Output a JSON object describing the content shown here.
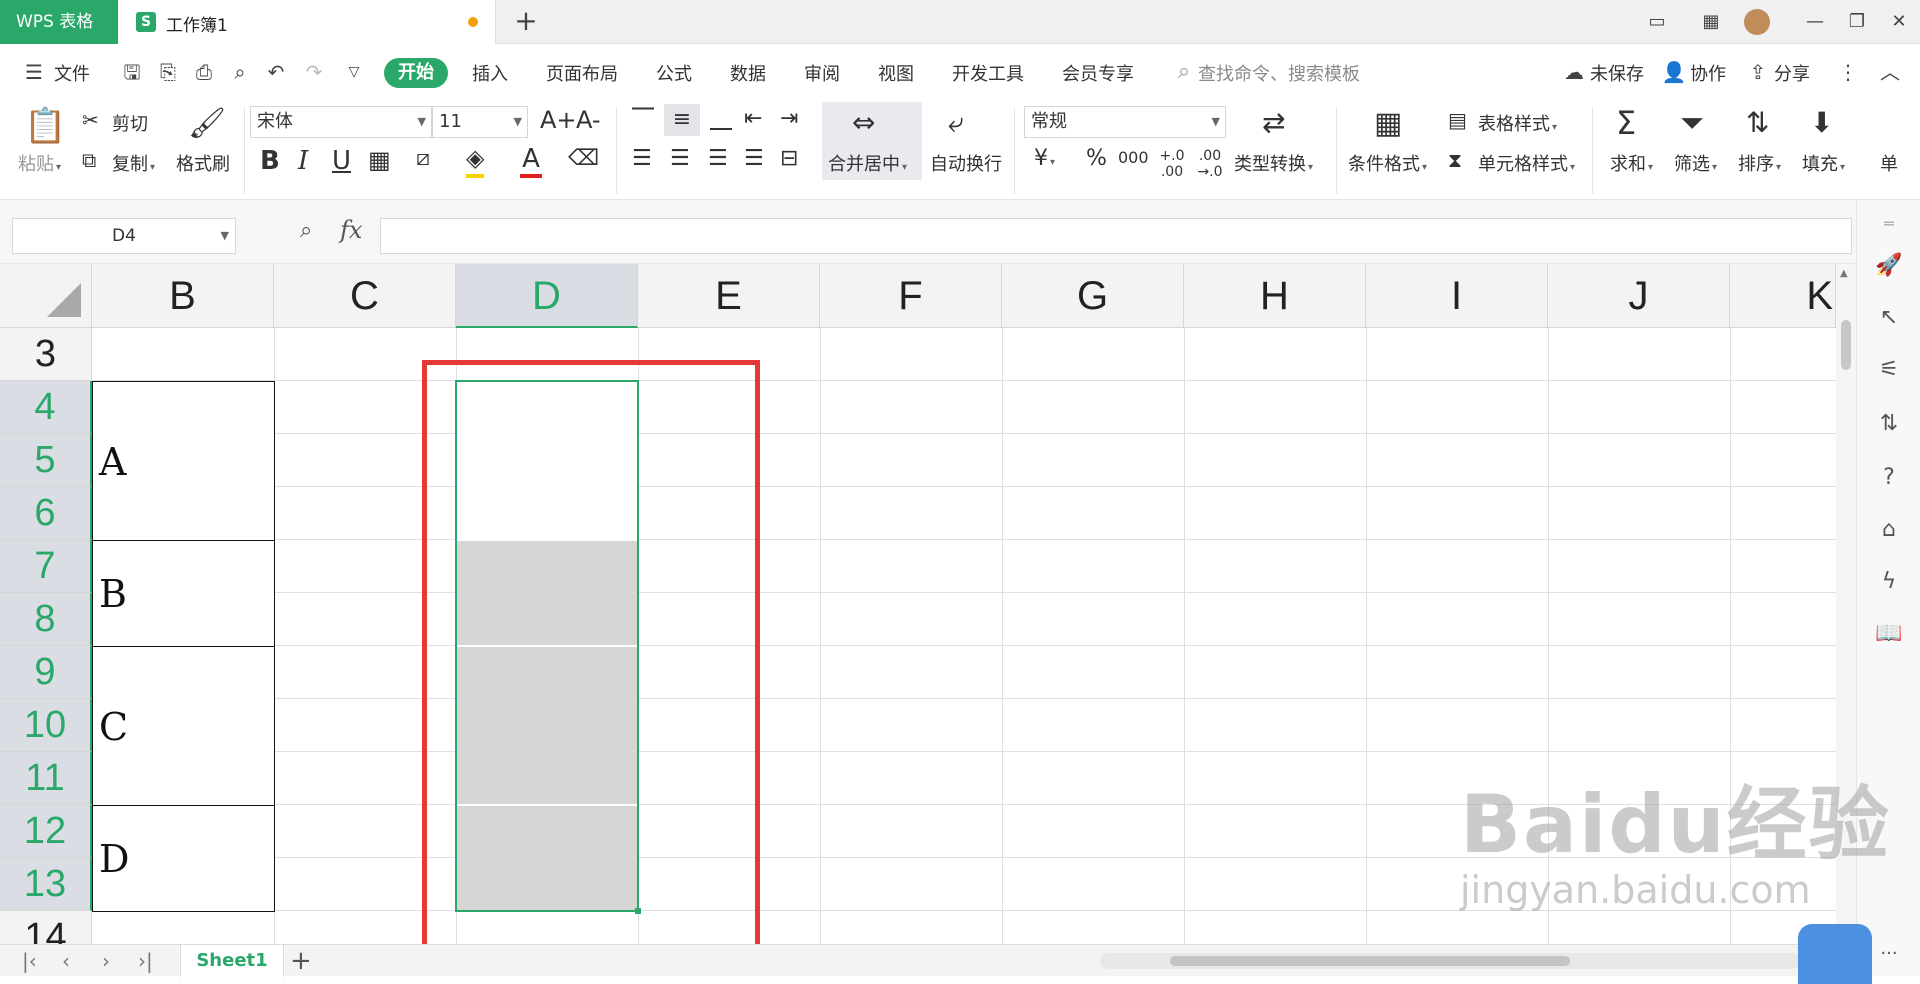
{
  "titlebar": {
    "app_tab": "WPS 表格",
    "doc_icon": "S",
    "doc_name": "工作簿1",
    "new_tab": "+"
  },
  "menubar": {
    "file": "文件",
    "tabs": [
      "开始",
      "插入",
      "页面布局",
      "公式",
      "数据",
      "审阅",
      "视图",
      "开发工具",
      "会员专享"
    ],
    "search_placeholder": "查找命令、搜索模板",
    "unsaved": "未保存",
    "collab": "协作",
    "share": "分享"
  },
  "ribbon": {
    "paste": "粘贴",
    "cut": "剪切",
    "copy": "复制",
    "format_painter": "格式刷",
    "font_name": "宋体",
    "font_size": "11",
    "merge_center": "合并居中",
    "wrap_text": "自动换行",
    "number_format": "常规",
    "type_convert": "类型转换",
    "cond_format": "条件格式",
    "table_style": "表格样式",
    "cell_style": "单元格样式",
    "sum": "求和",
    "filter": "筛选",
    "sort": "排序",
    "fill": "填充",
    "single": "单",
    "bold": "B",
    "italic": "I",
    "underline": "U",
    "currency": "¥",
    "percent": "%",
    "thousands": "000",
    "inc_decimal": "+.0 .00",
    "dec_decimal": ".00 →.0",
    "font_grow": "A+",
    "font_shrink": "A-",
    "font_color": "A"
  },
  "formulabar": {
    "cell_ref": "D4",
    "fx": "fx",
    "formula": ""
  },
  "grid": {
    "columns": [
      "B",
      "C",
      "D",
      "E",
      "F",
      "G",
      "H",
      "I",
      "J",
      "K"
    ],
    "selected_column": "D",
    "rows": [
      "3",
      "4",
      "5",
      "6",
      "7",
      "8",
      "9",
      "10",
      "11",
      "12",
      "13",
      "14"
    ],
    "selected_rows": [
      "4",
      "5",
      "6",
      "7",
      "8",
      "9",
      "10",
      "11",
      "12",
      "13"
    ],
    "merged_b": [
      "A",
      "B",
      "C",
      "D"
    ]
  },
  "sheets": {
    "active": "Sheet1",
    "add": "+"
  },
  "watermark": {
    "brand": "Baidu经验",
    "sub": "jingyan.baidu.com"
  },
  "colors": {
    "accent": "#29a86a",
    "highlight": "#e53935",
    "gray_fill": "#d6d6d6"
  }
}
